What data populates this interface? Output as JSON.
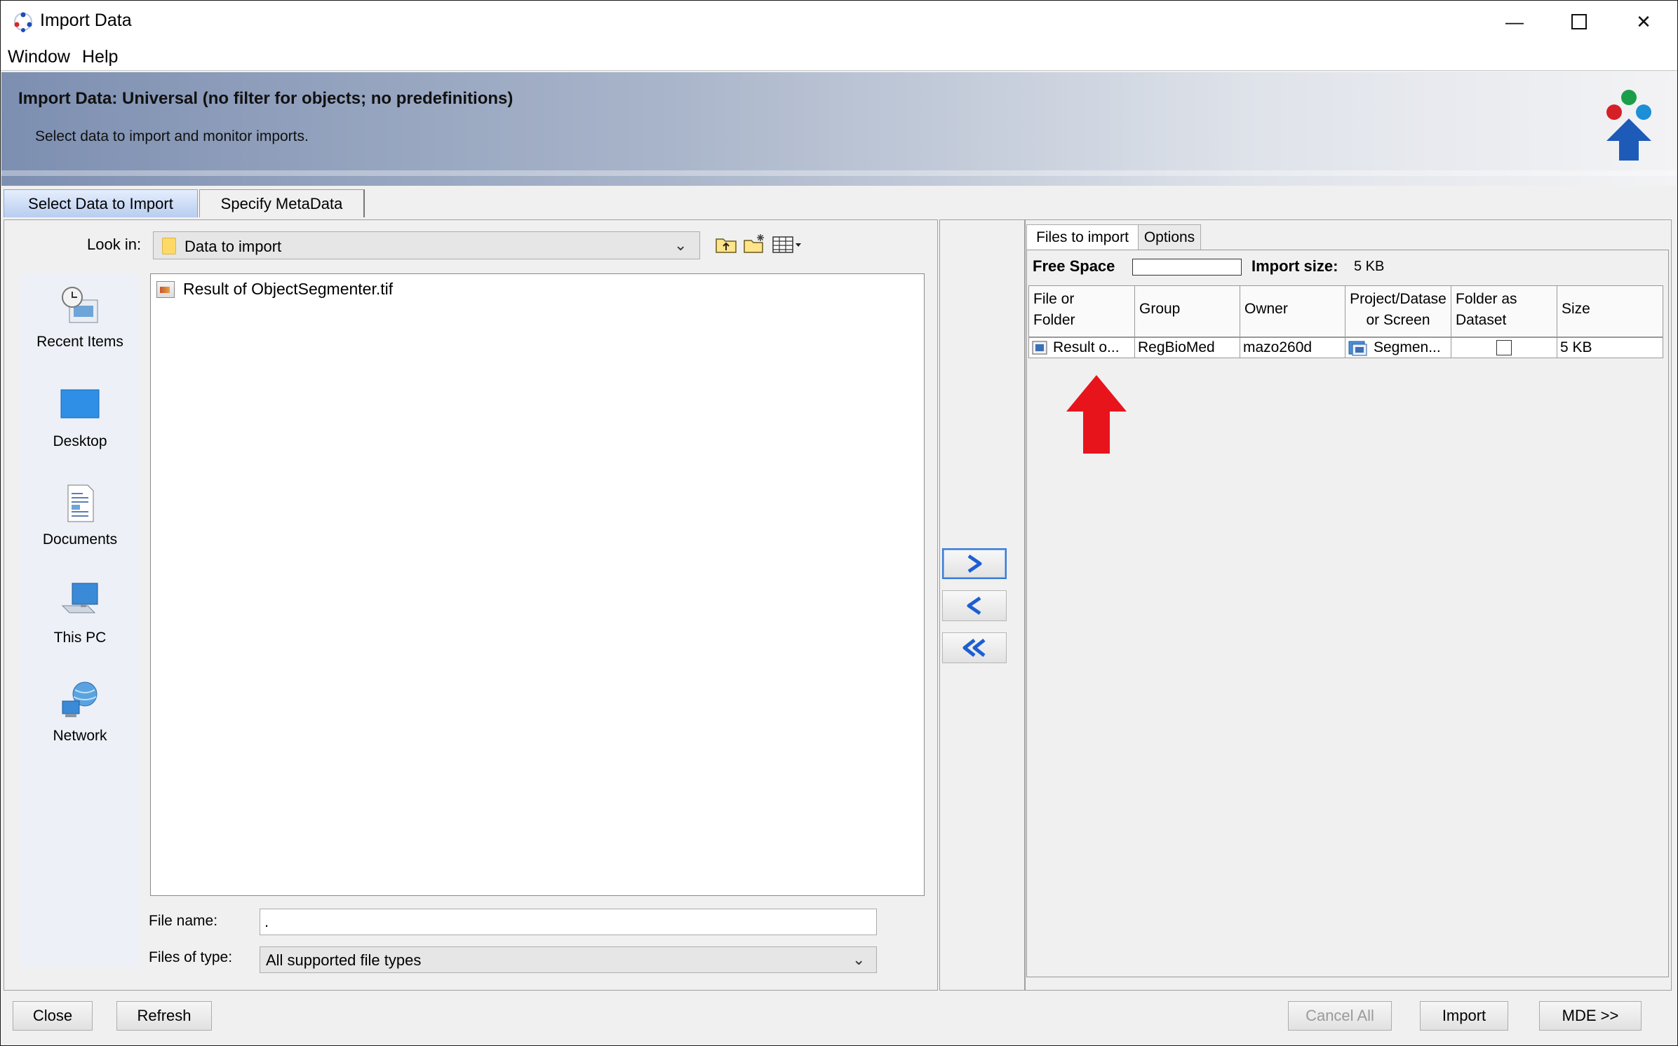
{
  "window": {
    "title": "Import Data"
  },
  "menu": {
    "items": [
      "Window",
      "Help"
    ]
  },
  "banner": {
    "title": "Import Data: Universal (no filter for objects; no predefinitions)",
    "subtitle": "Select data to import and monitor imports."
  },
  "tabs": {
    "select": "Select Data to Import",
    "metadata": "Specify MetaData"
  },
  "chooser": {
    "look_in_label": "Look in:",
    "look_in_value": "Data to import",
    "places": [
      "Recent Items",
      "Desktop",
      "Documents",
      "This PC",
      "Network"
    ],
    "files": [
      "Result of ObjectSegmenter.tif"
    ],
    "file_name_label": "File name:",
    "file_name_value": ".",
    "file_type_label": "Files of type:",
    "file_type_value": "All supported file types"
  },
  "import_panel": {
    "tabs": [
      "Files to import",
      "Options"
    ],
    "free_space_label": "Free Space",
    "import_size_label": "Import size:",
    "import_size_value": "5 KB",
    "columns": {
      "file": [
        "File or",
        "Folder"
      ],
      "group": "Group",
      "owner": "Owner",
      "project": [
        "Project/Datase",
        "or Screen"
      ],
      "folder_as_dataset": [
        "Folder as",
        "Dataset"
      ],
      "size": "Size"
    },
    "rows": [
      {
        "file": "Result o...",
        "group": "RegBioMed",
        "owner": "mazo260d",
        "project": "Segmen...",
        "folder_as_dataset": false,
        "size": "5 KB"
      }
    ]
  },
  "footer": {
    "close": "Close",
    "refresh": "Refresh",
    "cancel_all": "Cancel All",
    "import": "Import",
    "mde": "MDE >>"
  },
  "colors": {
    "annotation_arrow": "#e8141c",
    "banner": "#7d8fb1",
    "selected_tab": "#b8cdf0"
  }
}
